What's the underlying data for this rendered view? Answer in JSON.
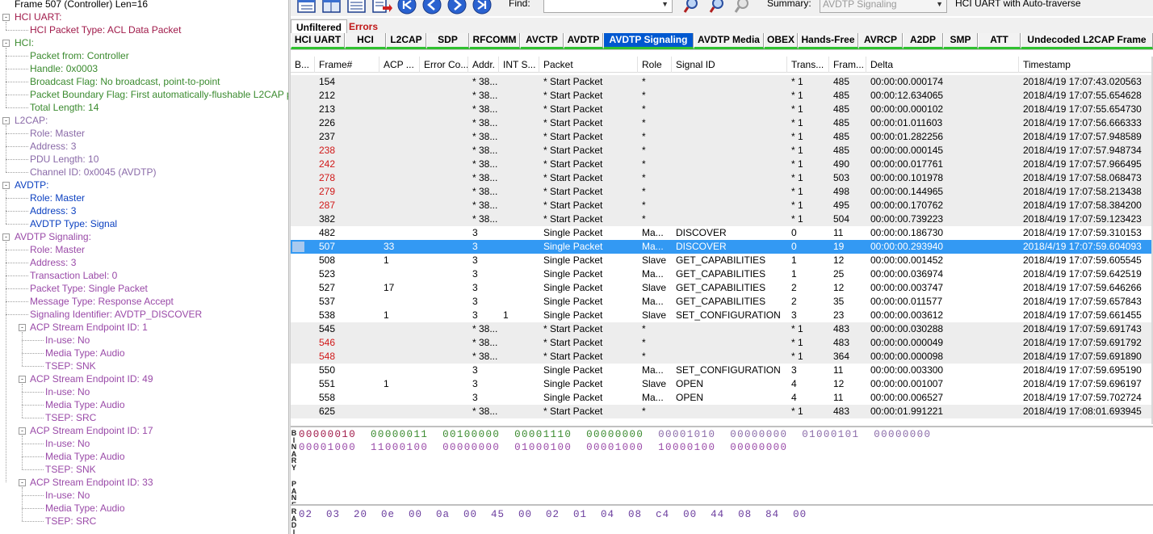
{
  "tree": {
    "nodes": [
      {
        "text": "Frame 507 (Controller) Len=16",
        "depth": 0,
        "color": "#000000",
        "box": ""
      },
      {
        "text": "HCI UART:",
        "depth": 0,
        "color": "#a01a4a",
        "box": "-"
      },
      {
        "text": "HCI Packet Type: ACL Data Packet",
        "depth": 1,
        "color": "#a01a4a",
        "box": ""
      },
      {
        "text": "HCI:",
        "depth": 0,
        "color": "#3a8a2e",
        "box": "-"
      },
      {
        "text": "Packet from: Controller",
        "depth": 1,
        "color": "#3a8a2e",
        "box": ""
      },
      {
        "text": "Handle: 0x0003",
        "depth": 1,
        "color": "#3a8a2e",
        "box": ""
      },
      {
        "text": "Broadcast Flag: No broadcast, point-to-point",
        "depth": 1,
        "color": "#3a8a2e",
        "box": ""
      },
      {
        "text": "Packet Boundary Flag: First automatically-flushable L2CAP packet",
        "depth": 1,
        "color": "#3a8a2e",
        "box": ""
      },
      {
        "text": "Total Length: 14",
        "depth": 1,
        "color": "#3a8a2e",
        "box": ""
      },
      {
        "text": "L2CAP:",
        "depth": 0,
        "color": "#8a6aa8",
        "box": "-"
      },
      {
        "text": "Role: Master",
        "depth": 1,
        "color": "#8a6aa8",
        "box": ""
      },
      {
        "text": "Address: 3",
        "depth": 1,
        "color": "#8a6aa8",
        "box": ""
      },
      {
        "text": "PDU Length: 10",
        "depth": 1,
        "color": "#8a6aa8",
        "box": ""
      },
      {
        "text": "Channel ID: 0x0045  (AVDTP)",
        "depth": 1,
        "color": "#8a6aa8",
        "box": ""
      },
      {
        "text": "AVDTP:",
        "depth": 0,
        "color": "#0a3fc0",
        "box": "-"
      },
      {
        "text": "Role: Master",
        "depth": 1,
        "color": "#0a3fc0",
        "box": ""
      },
      {
        "text": "Address: 3",
        "depth": 1,
        "color": "#0a3fc0",
        "box": ""
      },
      {
        "text": "AVDTP Type: Signal",
        "depth": 1,
        "color": "#0a3fc0",
        "box": ""
      },
      {
        "text": "AVDTP Signaling:",
        "depth": 0,
        "color": "#9a4aa8",
        "box": "-"
      },
      {
        "text": "Role: Master",
        "depth": 1,
        "color": "#9a4aa8",
        "box": ""
      },
      {
        "text": "Address: 3",
        "depth": 1,
        "color": "#9a4aa8",
        "box": ""
      },
      {
        "text": "Transaction Label: 0",
        "depth": 1,
        "color": "#9a4aa8",
        "box": ""
      },
      {
        "text": "Packet Type: Single Packet",
        "depth": 1,
        "color": "#9a4aa8",
        "box": ""
      },
      {
        "text": "Message Type: Response Accept",
        "depth": 1,
        "color": "#9a4aa8",
        "box": ""
      },
      {
        "text": "Signaling Identifier: AVDTP_DISCOVER",
        "depth": 1,
        "color": "#9a4aa8",
        "box": ""
      },
      {
        "text": "ACP Stream Endpoint ID: 1",
        "depth": 1,
        "color": "#9a4aa8",
        "box": "-"
      },
      {
        "text": "In-use: No",
        "depth": 2,
        "color": "#9a4aa8",
        "box": ""
      },
      {
        "text": "Media Type: Audio",
        "depth": 2,
        "color": "#9a4aa8",
        "box": ""
      },
      {
        "text": "TSEP: SNK",
        "depth": 2,
        "color": "#9a4aa8",
        "box": ""
      },
      {
        "text": "ACP Stream Endpoint ID: 49",
        "depth": 1,
        "color": "#9a4aa8",
        "box": "-"
      },
      {
        "text": "In-use: No",
        "depth": 2,
        "color": "#9a4aa8",
        "box": ""
      },
      {
        "text": "Media Type: Audio",
        "depth": 2,
        "color": "#9a4aa8",
        "box": ""
      },
      {
        "text": "TSEP: SRC",
        "depth": 2,
        "color": "#9a4aa8",
        "box": ""
      },
      {
        "text": "ACP Stream Endpoint ID: 17",
        "depth": 1,
        "color": "#9a4aa8",
        "box": "-"
      },
      {
        "text": "In-use: No",
        "depth": 2,
        "color": "#9a4aa8",
        "box": ""
      },
      {
        "text": "Media Type: Audio",
        "depth": 2,
        "color": "#9a4aa8",
        "box": ""
      },
      {
        "text": "TSEP: SNK",
        "depth": 2,
        "color": "#9a4aa8",
        "box": ""
      },
      {
        "text": "ACP Stream Endpoint ID: 33",
        "depth": 1,
        "color": "#9a4aa8",
        "box": "-"
      },
      {
        "text": "In-use: No",
        "depth": 2,
        "color": "#9a4aa8",
        "box": ""
      },
      {
        "text": "Media Type: Audio",
        "depth": 2,
        "color": "#9a4aa8",
        "box": ""
      },
      {
        "text": "TSEP: SRC",
        "depth": 2,
        "color": "#9a4aa8",
        "box": ""
      }
    ]
  },
  "toolbar": {
    "find_label": "Find:",
    "find_value": "",
    "summary_label": "Summary:",
    "summary_value": "AVDTP Signaling",
    "status_text": "HCI UART with Auto-traverse",
    "icons": [
      "frame-view-icon",
      "pane-view-icon",
      "list-view-icon",
      "export-icon",
      "go-first-icon",
      "go-prev-icon",
      "go-next-icon",
      "go-last-icon",
      "find-icon",
      "find-next-icon",
      "find-prev-icon"
    ]
  },
  "filter_tabs": [
    {
      "label": "Unfiltered",
      "color": "#000000"
    },
    {
      "label": "Errors",
      "color": "#c01818"
    }
  ],
  "protocol_tabs": [
    {
      "label": "HCI UART",
      "active": false
    },
    {
      "label": "HCI",
      "active": false
    },
    {
      "label": "L2CAP",
      "active": false
    },
    {
      "label": "SDP",
      "active": false
    },
    {
      "label": "RFCOMM",
      "active": false
    },
    {
      "label": "AVCTP",
      "active": false
    },
    {
      "label": "AVDTP",
      "active": false
    },
    {
      "label": "AVDTP Signaling",
      "active": true
    },
    {
      "label": "AVDTP Media",
      "active": false
    },
    {
      "label": "OBEX",
      "active": false
    },
    {
      "label": "Hands-Free",
      "active": false
    },
    {
      "label": "AVRCP",
      "active": false
    },
    {
      "label": "A2DP",
      "active": false
    },
    {
      "label": "SMP",
      "active": false
    },
    {
      "label": "ATT",
      "active": false
    },
    {
      "label": "Undecoded L2CAP Frame",
      "active": false
    }
  ],
  "grid": {
    "columns": [
      "B...",
      "Frame#",
      "ACP ...",
      "Error Co...",
      "Addr.",
      "INT S...",
      "Packet",
      "Role",
      "Signal ID",
      "Trans...",
      "Fram...",
      "Delta",
      "Timestamp"
    ],
    "rows": [
      {
        "frame": "154",
        "acp": "",
        "err": "",
        "addr": "* 38...",
        "int": "",
        "packet": "* Start Packet",
        "role": "*",
        "signal": "",
        "trans": "* 1",
        "fram": "485",
        "delta": "00:00:00.000174",
        "ts": "2018/4/19 17:07:43.020563",
        "red": false,
        "bg": "gray"
      },
      {
        "frame": "212",
        "acp": "",
        "err": "",
        "addr": "* 38...",
        "int": "",
        "packet": "* Start Packet",
        "role": "*",
        "signal": "",
        "trans": "* 1",
        "fram": "485",
        "delta": "00:00:12.634065",
        "ts": "2018/4/19 17:07:55.654628",
        "red": false,
        "bg": "gray"
      },
      {
        "frame": "213",
        "acp": "",
        "err": "",
        "addr": "* 38...",
        "int": "",
        "packet": "* Start Packet",
        "role": "*",
        "signal": "",
        "trans": "* 1",
        "fram": "485",
        "delta": "00:00:00.000102",
        "ts": "2018/4/19 17:07:55.654730",
        "red": false,
        "bg": "gray"
      },
      {
        "frame": "226",
        "acp": "",
        "err": "",
        "addr": "* 38...",
        "int": "",
        "packet": "* Start Packet",
        "role": "*",
        "signal": "",
        "trans": "* 1",
        "fram": "485",
        "delta": "00:00:01.011603",
        "ts": "2018/4/19 17:07:56.666333",
        "red": false,
        "bg": "gray"
      },
      {
        "frame": "237",
        "acp": "",
        "err": "",
        "addr": "* 38...",
        "int": "",
        "packet": "* Start Packet",
        "role": "*",
        "signal": "",
        "trans": "* 1",
        "fram": "485",
        "delta": "00:00:01.282256",
        "ts": "2018/4/19 17:07:57.948589",
        "red": false,
        "bg": "gray"
      },
      {
        "frame": "238",
        "acp": "",
        "err": "",
        "addr": "* 38...",
        "int": "",
        "packet": "* Start Packet",
        "role": "*",
        "signal": "",
        "trans": "* 1",
        "fram": "485",
        "delta": "00:00:00.000145",
        "ts": "2018/4/19 17:07:57.948734",
        "red": true,
        "bg": "gray"
      },
      {
        "frame": "242",
        "acp": "",
        "err": "",
        "addr": "* 38...",
        "int": "",
        "packet": "* Start Packet",
        "role": "*",
        "signal": "",
        "trans": "* 1",
        "fram": "490",
        "delta": "00:00:00.017761",
        "ts": "2018/4/19 17:07:57.966495",
        "red": true,
        "bg": "gray"
      },
      {
        "frame": "278",
        "acp": "",
        "err": "",
        "addr": "* 38...",
        "int": "",
        "packet": "* Start Packet",
        "role": "*",
        "signal": "",
        "trans": "* 1",
        "fram": "503",
        "delta": "00:00:00.101978",
        "ts": "2018/4/19 17:07:58.068473",
        "red": true,
        "bg": "gray"
      },
      {
        "frame": "279",
        "acp": "",
        "err": "",
        "addr": "* 38...",
        "int": "",
        "packet": "* Start Packet",
        "role": "*",
        "signal": "",
        "trans": "* 1",
        "fram": "498",
        "delta": "00:00:00.144965",
        "ts": "2018/4/19 17:07:58.213438",
        "red": true,
        "bg": "gray"
      },
      {
        "frame": "287",
        "acp": "",
        "err": "",
        "addr": "* 38...",
        "int": "",
        "packet": "* Start Packet",
        "role": "*",
        "signal": "",
        "trans": "* 1",
        "fram": "495",
        "delta": "00:00:00.170762",
        "ts": "2018/4/19 17:07:58.384200",
        "red": true,
        "bg": "gray"
      },
      {
        "frame": "382",
        "acp": "",
        "err": "",
        "addr": "* 38...",
        "int": "",
        "packet": "* Start Packet",
        "role": "*",
        "signal": "",
        "trans": "* 1",
        "fram": "504",
        "delta": "00:00:00.739223",
        "ts": "2018/4/19 17:07:59.123423",
        "red": false,
        "bg": "gray"
      },
      {
        "frame": "482",
        "acp": "",
        "err": "",
        "addr": "3",
        "int": "",
        "packet": "Single Packet",
        "role": "Ma...",
        "signal": "DISCOVER",
        "trans": "0",
        "fram": "11",
        "delta": "00:00:00.186730",
        "ts": "2018/4/19 17:07:59.310153",
        "red": false,
        "bg": "white"
      },
      {
        "frame": "507",
        "acp": "33",
        "err": "",
        "addr": "3",
        "int": "",
        "packet": "Single Packet",
        "role": "Ma...",
        "signal": "DISCOVER",
        "trans": "0",
        "fram": "19",
        "delta": "00:00:00.293940",
        "ts": "2018/4/19 17:07:59.604093",
        "red": false,
        "bg": "sel"
      },
      {
        "frame": "508",
        "acp": "1",
        "err": "",
        "addr": "3",
        "int": "",
        "packet": "Single Packet",
        "role": "Slave",
        "signal": "GET_CAPABILITIES",
        "trans": "1",
        "fram": "12",
        "delta": "00:00:00.001452",
        "ts": "2018/4/19 17:07:59.605545",
        "red": false,
        "bg": "white"
      },
      {
        "frame": "523",
        "acp": "",
        "err": "",
        "addr": "3",
        "int": "",
        "packet": "Single Packet",
        "role": "Ma...",
        "signal": "GET_CAPABILITIES",
        "trans": "1",
        "fram": "25",
        "delta": "00:00:00.036974",
        "ts": "2018/4/19 17:07:59.642519",
        "red": false,
        "bg": "white"
      },
      {
        "frame": "527",
        "acp": "17",
        "err": "",
        "addr": "3",
        "int": "",
        "packet": "Single Packet",
        "role": "Slave",
        "signal": "GET_CAPABILITIES",
        "trans": "2",
        "fram": "12",
        "delta": "00:00:00.003747",
        "ts": "2018/4/19 17:07:59.646266",
        "red": false,
        "bg": "white"
      },
      {
        "frame": "537",
        "acp": "",
        "err": "",
        "addr": "3",
        "int": "",
        "packet": "Single Packet",
        "role": "Ma...",
        "signal": "GET_CAPABILITIES",
        "trans": "2",
        "fram": "35",
        "delta": "00:00:00.011577",
        "ts": "2018/4/19 17:07:59.657843",
        "red": false,
        "bg": "white"
      },
      {
        "frame": "538",
        "acp": "1",
        "err": "",
        "addr": "3",
        "int": "1",
        "packet": "Single Packet",
        "role": "Slave",
        "signal": "SET_CONFIGURATION",
        "trans": "3",
        "fram": "23",
        "delta": "00:00:00.003612",
        "ts": "2018/4/19 17:07:59.661455",
        "red": false,
        "bg": "white"
      },
      {
        "frame": "545",
        "acp": "",
        "err": "",
        "addr": "* 38...",
        "int": "",
        "packet": "* Start Packet",
        "role": "*",
        "signal": "",
        "trans": "* 1",
        "fram": "483",
        "delta": "00:00:00.030288",
        "ts": "2018/4/19 17:07:59.691743",
        "red": false,
        "bg": "gray"
      },
      {
        "frame": "546",
        "acp": "",
        "err": "",
        "addr": "* 38...",
        "int": "",
        "packet": "* Start Packet",
        "role": "*",
        "signal": "",
        "trans": "* 1",
        "fram": "483",
        "delta": "00:00:00.000049",
        "ts": "2018/4/19 17:07:59.691792",
        "red": true,
        "bg": "gray"
      },
      {
        "frame": "548",
        "acp": "",
        "err": "",
        "addr": "* 38...",
        "int": "",
        "packet": "* Start Packet",
        "role": "*",
        "signal": "",
        "trans": "* 1",
        "fram": "364",
        "delta": "00:00:00.000098",
        "ts": "2018/4/19 17:07:59.691890",
        "red": true,
        "bg": "gray"
      },
      {
        "frame": "550",
        "acp": "",
        "err": "",
        "addr": "3",
        "int": "",
        "packet": "Single Packet",
        "role": "Ma...",
        "signal": "SET_CONFIGURATION",
        "trans": "3",
        "fram": "11",
        "delta": "00:00:00.003300",
        "ts": "2018/4/19 17:07:59.695190",
        "red": false,
        "bg": "white"
      },
      {
        "frame": "551",
        "acp": "1",
        "err": "",
        "addr": "3",
        "int": "",
        "packet": "Single Packet",
        "role": "Slave",
        "signal": "OPEN",
        "trans": "4",
        "fram": "12",
        "delta": "00:00:00.001007",
        "ts": "2018/4/19 17:07:59.696197",
        "red": false,
        "bg": "white"
      },
      {
        "frame": "558",
        "acp": "",
        "err": "",
        "addr": "3",
        "int": "",
        "packet": "Single Packet",
        "role": "Ma...",
        "signal": "OPEN",
        "trans": "4",
        "fram": "11",
        "delta": "00:00:00.006527",
        "ts": "2018/4/19 17:07:59.702724",
        "red": false,
        "bg": "white"
      },
      {
        "frame": "625",
        "acp": "",
        "err": "",
        "addr": "* 38...",
        "int": "",
        "packet": "* Start Packet",
        "role": "*",
        "signal": "",
        "trans": "* 1",
        "fram": "483",
        "delta": "00:00:01.991221",
        "ts": "2018/4/19 17:08:01.693945",
        "red": false,
        "bg": "gray"
      }
    ]
  },
  "binary_pane": {
    "label": "BINARY PANE",
    "line1": [
      {
        "text": "00000010",
        "color": "#a01a4a"
      },
      {
        "text": "00000011",
        "color": "#3a8a2e"
      },
      {
        "text": "00100000",
        "color": "#3a8a2e"
      },
      {
        "text": "00001110",
        "color": "#3a8a2e"
      },
      {
        "text": "00000000",
        "color": "#3a8a2e"
      },
      {
        "text": "00001010",
        "color": "#8a6aa8"
      },
      {
        "text": "00000000",
        "color": "#8a6aa8"
      },
      {
        "text": "01000101",
        "color": "#8a6aa8"
      },
      {
        "text": "00000000",
        "color": "#8a6aa8"
      }
    ],
    "line2": [
      {
        "text": "00001000",
        "color": "#9a4aa8"
      },
      {
        "text": "11000100",
        "color": "#9a4aa8"
      },
      {
        "text": "00000000",
        "color": "#9a4aa8"
      },
      {
        "text": "01000100",
        "color": "#9a4aa8"
      },
      {
        "text": "00001000",
        "color": "#9a4aa8"
      },
      {
        "text": "10000100",
        "color": "#9a4aa8"
      },
      {
        "text": "00000000",
        "color": "#9a4aa8"
      }
    ]
  },
  "radix_pane": {
    "label": "RADIX",
    "hex": "02  03  20  0e  00  0a  00  45  00  02  01  04  08  c4  00  44  08  84  00"
  }
}
